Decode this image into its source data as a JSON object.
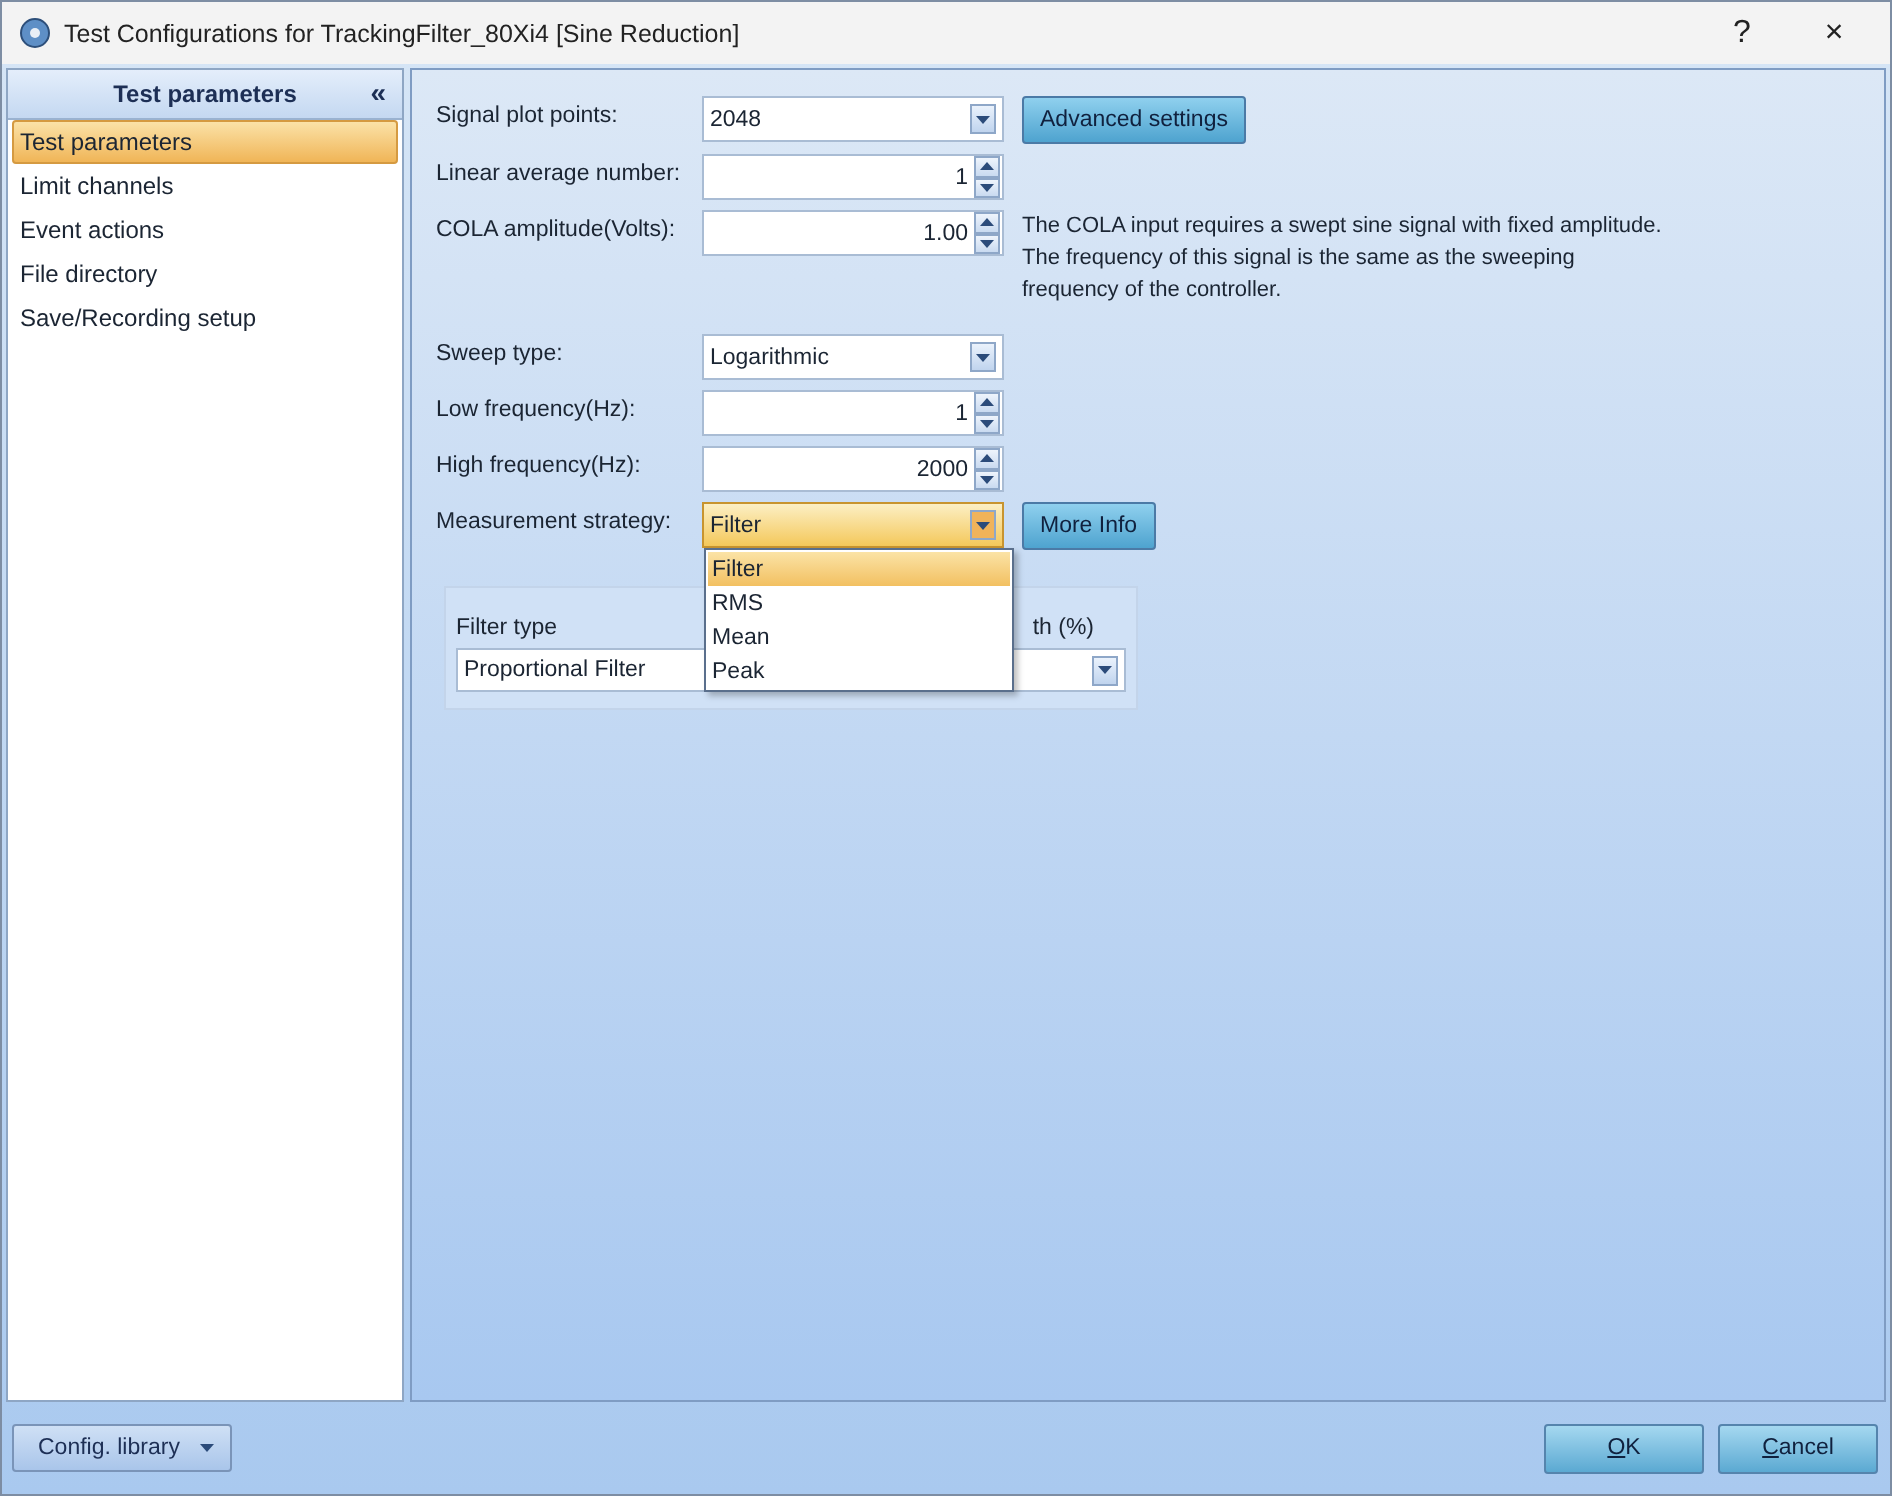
{
  "window": {
    "title": "Test Configurations for TrackingFilter_80Xi4 [Sine Reduction]",
    "help": "?",
    "close": "×"
  },
  "sidebar": {
    "title": "Test parameters",
    "collapse": "«",
    "items": [
      {
        "label": "Test parameters",
        "selected": true
      },
      {
        "label": "Limit channels",
        "selected": false
      },
      {
        "label": "Event actions",
        "selected": false
      },
      {
        "label": "File directory",
        "selected": false
      },
      {
        "label": "Save/Recording setup",
        "selected": false
      }
    ]
  },
  "fields": [
    {
      "label": "Signal plot points:",
      "kind": "combo",
      "value": "2048",
      "button": "Advanced settings",
      "open": false
    },
    {
      "label": "Linear average number:",
      "kind": "spin",
      "value": "1"
    },
    {
      "label": "COLA amplitude(Volts):",
      "kind": "spin",
      "value": "1.00",
      "note": "The COLA input requires a swept sine signal with fixed amplitude.\nThe frequency of this signal is the same as the sweeping\nfrequency of the controller."
    },
    {
      "label": "Sweep type:",
      "kind": "combo",
      "value": "Logarithmic",
      "open": false
    },
    {
      "label": "Low frequency(Hz):",
      "kind": "spin",
      "value": "1"
    },
    {
      "label": "High frequency(Hz):",
      "kind": "spin",
      "value": "2000"
    },
    {
      "label": "Measurement strategy:",
      "kind": "combo",
      "value": "Filter",
      "button": "More Info",
      "open": true,
      "options": [
        {
          "label": "Filter",
          "selected": true
        },
        {
          "label": "RMS",
          "selected": false
        },
        {
          "label": "Mean",
          "selected": false
        },
        {
          "label": "Peak",
          "selected": false
        }
      ]
    }
  ],
  "filter_group": {
    "filter_type_label": "Filter type",
    "filter_type_value": "Proportional Filter",
    "column_2_label": "th (%)"
  },
  "footer": {
    "library_button": "Config. library",
    "ok": "OK",
    "cancel": "Cancel"
  }
}
